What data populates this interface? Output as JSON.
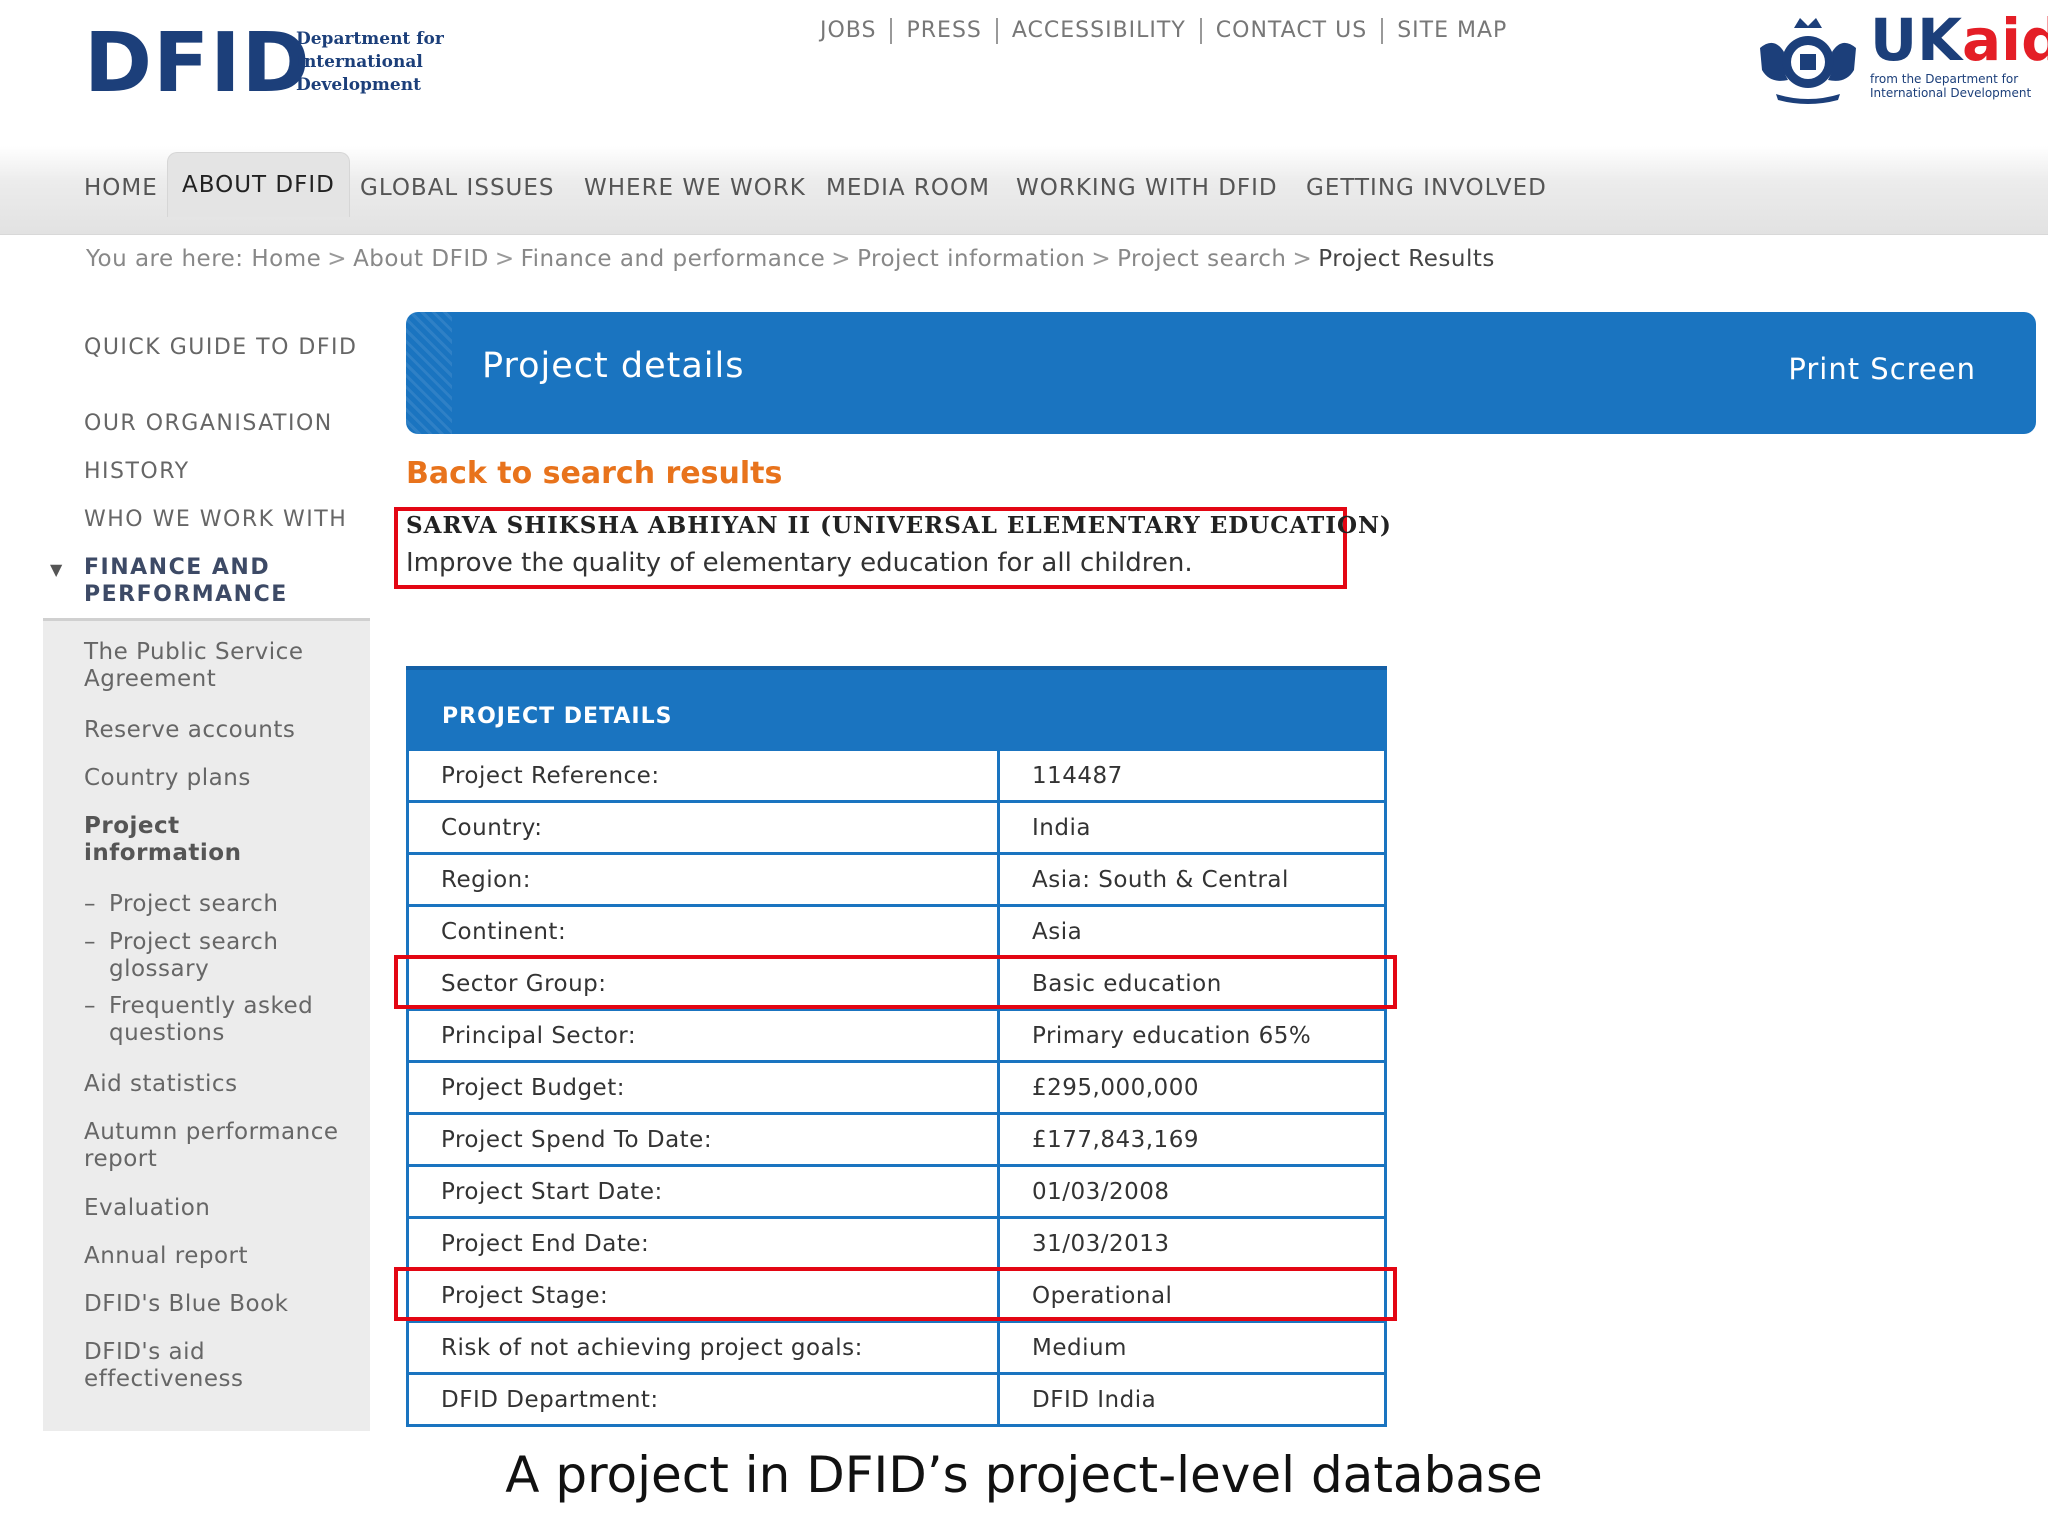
{
  "header": {
    "logo": {
      "main": "DFID",
      "lines": [
        "Department for",
        "International",
        "Development"
      ]
    },
    "top_links": [
      "JOBS",
      "PRESS",
      "ACCESSIBILITY",
      "CONTACT US",
      "SITE MAP"
    ],
    "ukaid": {
      "uk": "UK",
      "aid": "aid",
      "line1": "from the Department for",
      "line2": "International Development"
    }
  },
  "nav": [
    "HOME",
    "ABOUT DFID",
    "GLOBAL ISSUES",
    "WHERE WE WORK",
    "MEDIA ROOM",
    "WORKING WITH DFID",
    "GETTING INVOLVED"
  ],
  "breadcrumb": {
    "prefix": "You are here:",
    "items": [
      "Home",
      "About DFID",
      "Finance and performance",
      "Project information",
      "Project search"
    ],
    "separator": ">",
    "current": "Project Results"
  },
  "sidebar": {
    "top": [
      "QUICK GUIDE TO DFID",
      "OUR ORGANISATION",
      "HISTORY",
      "WHO WE WORK WITH"
    ],
    "section": "FINANCE AND PERFORMANCE",
    "items": [
      "The Public Service Agreement",
      "Reserve accounts",
      "Country plans",
      "Project information",
      "Aid statistics",
      "Autumn performance report",
      "Evaluation",
      "Annual report",
      "DFID's Blue Book",
      "DFID's aid effectiveness"
    ],
    "subitems": [
      "Project search",
      "Project search glossary",
      "Frequently asked questions"
    ],
    "dash": "–"
  },
  "banner": {
    "title": "Project details",
    "print": "Print Screen"
  },
  "back_link": "Back to search results",
  "project": {
    "title": "SARVA SHIKSHA ABHIYAN II (UNIVERSAL ELEMENTARY EDUCATION)",
    "description": "Improve the quality of elementary education for all children."
  },
  "details": {
    "heading": "PROJECT DETAILS",
    "rows": [
      {
        "label": "Project Reference:",
        "value": "114487"
      },
      {
        "label": "Country:",
        "value": "India"
      },
      {
        "label": "Region:",
        "value": "Asia: South & Central"
      },
      {
        "label": "Continent:",
        "value": "Asia"
      },
      {
        "label": "Sector Group:",
        "value": "Basic education"
      },
      {
        "label": "Principal Sector:",
        "value": "Primary education 65%"
      },
      {
        "label": "Project Budget:",
        "value": "£295,000,000"
      },
      {
        "label": "Project Spend To Date:",
        "value": "£177,843,169"
      },
      {
        "label": "Project Start Date:",
        "value": "01/03/2008"
      },
      {
        "label": "Project End Date:",
        "value": "31/03/2013"
      },
      {
        "label": "Project Stage:",
        "value": "Operational"
      },
      {
        "label": "Risk of not achieving project goals:",
        "value": "Medium"
      },
      {
        "label": "DFID Department:",
        "value": "DFID India"
      }
    ]
  },
  "caption": "A project in DFID’s project-level database",
  "colors": {
    "brand_navy": "#1c3f7a",
    "accent_blue": "#1a74c0",
    "highlight_red": "#e30613",
    "link_orange": "#e8731c",
    "aid_red": "#e41e26"
  }
}
